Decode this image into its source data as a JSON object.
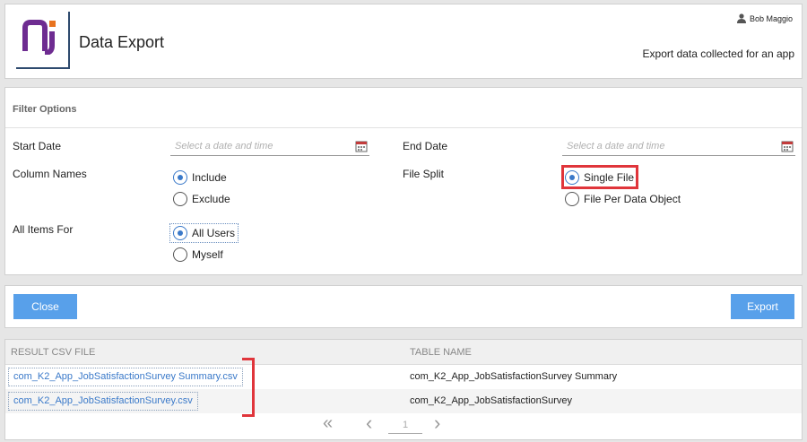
{
  "header": {
    "title": "Data Export",
    "user_name": "Bob Maggio",
    "subtitle": "Export data collected for an app",
    "logo_color": "#6e2c91"
  },
  "filter": {
    "title": "Filter Options",
    "start_date_label": "Start Date",
    "start_date_placeholder": "Select a date and time",
    "end_date_label": "End Date",
    "end_date_placeholder": "Select a date and time",
    "column_names_label": "Column Names",
    "column_names_options": [
      "Include",
      "Exclude"
    ],
    "column_names_selected": "Include",
    "file_split_label": "File Split",
    "file_split_options": [
      "Single File",
      "File Per Data Object"
    ],
    "file_split_selected": "Single File",
    "all_items_label": "All Items For",
    "all_items_options": [
      "All Users",
      "Myself"
    ],
    "all_items_selected": "All Users"
  },
  "actions": {
    "close_label": "Close",
    "export_label": "Export",
    "button_color": "#58a0ea"
  },
  "results": {
    "columns": [
      "RESULT CSV FILE",
      "TABLE NAME"
    ],
    "rows": [
      {
        "file": "com_K2_App_JobSatisfactionSurvey Summary.csv",
        "table": "com_K2_App_JobSatisfactionSurvey Summary"
      },
      {
        "file": "com_K2_App_JobSatisfactionSurvey.csv",
        "table": "com_K2_App_JobSatisfactionSurvey"
      }
    ],
    "pager": {
      "first": "«",
      "prev": "‹",
      "page": "1",
      "next": "›"
    }
  },
  "icons": [
    "user-icon",
    "calendar-icon",
    "first-page-icon",
    "prev-page-icon",
    "next-page-icon"
  ],
  "highlight_color": "#e0353b",
  "link_color": "#3a79c9"
}
